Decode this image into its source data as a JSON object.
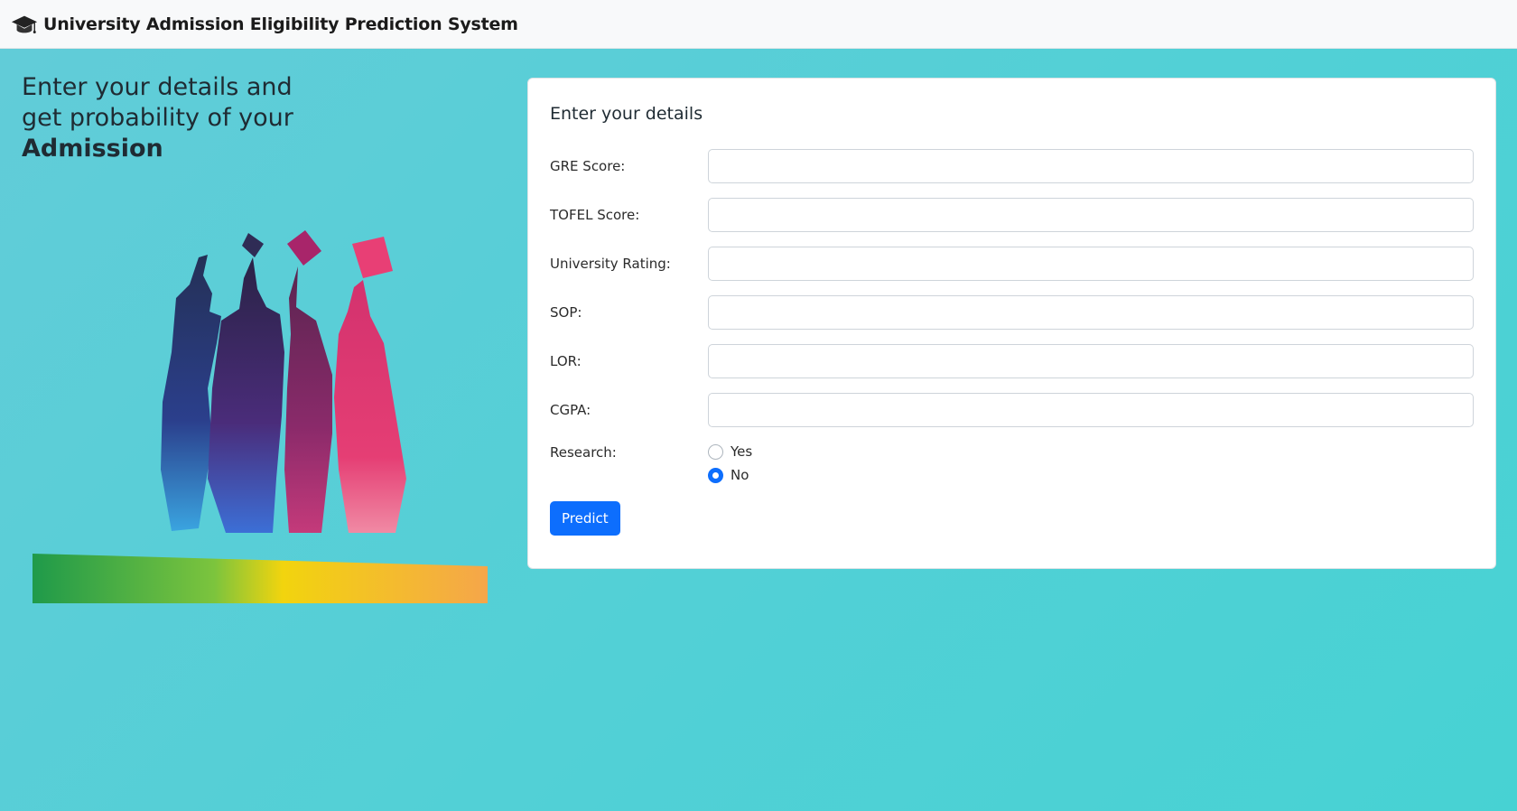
{
  "navbar": {
    "title": "University Admission Eligibility Prediction System",
    "icon": "graduation-cap-icon"
  },
  "hero": {
    "line1": "Enter your details and",
    "line2": "get probability of your",
    "line3": "Admission"
  },
  "form": {
    "title": "Enter your details",
    "fields": [
      {
        "label": "GRE Score:",
        "value": ""
      },
      {
        "label": "TOFEL Score:",
        "value": ""
      },
      {
        "label": "University Rating:",
        "value": ""
      },
      {
        "label": "SOP:",
        "value": ""
      },
      {
        "label": "LOR:",
        "value": ""
      },
      {
        "label": "CGPA:",
        "value": ""
      }
    ],
    "research": {
      "label": "Research:",
      "options": [
        "Yes",
        "No"
      ],
      "selected": "No"
    },
    "submit_label": "Predict"
  },
  "colors": {
    "accent": "#0d6efd",
    "background": "#52d0d6",
    "navbar": "#f8f9fa"
  }
}
